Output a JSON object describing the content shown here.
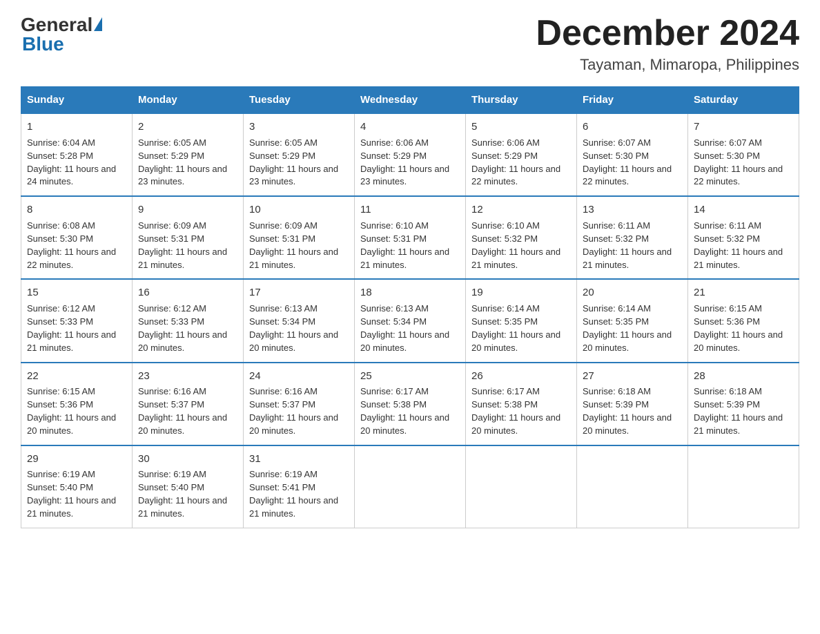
{
  "header": {
    "logo_general": "General",
    "logo_blue": "Blue",
    "main_title": "December 2024",
    "subtitle": "Tayaman, Mimaropa, Philippines"
  },
  "columns": [
    "Sunday",
    "Monday",
    "Tuesday",
    "Wednesday",
    "Thursday",
    "Friday",
    "Saturday"
  ],
  "weeks": [
    [
      {
        "day": "1",
        "sunrise": "6:04 AM",
        "sunset": "5:28 PM",
        "daylight": "11 hours and 24 minutes."
      },
      {
        "day": "2",
        "sunrise": "6:05 AM",
        "sunset": "5:29 PM",
        "daylight": "11 hours and 23 minutes."
      },
      {
        "day": "3",
        "sunrise": "6:05 AM",
        "sunset": "5:29 PM",
        "daylight": "11 hours and 23 minutes."
      },
      {
        "day": "4",
        "sunrise": "6:06 AM",
        "sunset": "5:29 PM",
        "daylight": "11 hours and 23 minutes."
      },
      {
        "day": "5",
        "sunrise": "6:06 AM",
        "sunset": "5:29 PM",
        "daylight": "11 hours and 22 minutes."
      },
      {
        "day": "6",
        "sunrise": "6:07 AM",
        "sunset": "5:30 PM",
        "daylight": "11 hours and 22 minutes."
      },
      {
        "day": "7",
        "sunrise": "6:07 AM",
        "sunset": "5:30 PM",
        "daylight": "11 hours and 22 minutes."
      }
    ],
    [
      {
        "day": "8",
        "sunrise": "6:08 AM",
        "sunset": "5:30 PM",
        "daylight": "11 hours and 22 minutes."
      },
      {
        "day": "9",
        "sunrise": "6:09 AM",
        "sunset": "5:31 PM",
        "daylight": "11 hours and 21 minutes."
      },
      {
        "day": "10",
        "sunrise": "6:09 AM",
        "sunset": "5:31 PM",
        "daylight": "11 hours and 21 minutes."
      },
      {
        "day": "11",
        "sunrise": "6:10 AM",
        "sunset": "5:31 PM",
        "daylight": "11 hours and 21 minutes."
      },
      {
        "day": "12",
        "sunrise": "6:10 AM",
        "sunset": "5:32 PM",
        "daylight": "11 hours and 21 minutes."
      },
      {
        "day": "13",
        "sunrise": "6:11 AM",
        "sunset": "5:32 PM",
        "daylight": "11 hours and 21 minutes."
      },
      {
        "day": "14",
        "sunrise": "6:11 AM",
        "sunset": "5:32 PM",
        "daylight": "11 hours and 21 minutes."
      }
    ],
    [
      {
        "day": "15",
        "sunrise": "6:12 AM",
        "sunset": "5:33 PM",
        "daylight": "11 hours and 21 minutes."
      },
      {
        "day": "16",
        "sunrise": "6:12 AM",
        "sunset": "5:33 PM",
        "daylight": "11 hours and 20 minutes."
      },
      {
        "day": "17",
        "sunrise": "6:13 AM",
        "sunset": "5:34 PM",
        "daylight": "11 hours and 20 minutes."
      },
      {
        "day": "18",
        "sunrise": "6:13 AM",
        "sunset": "5:34 PM",
        "daylight": "11 hours and 20 minutes."
      },
      {
        "day": "19",
        "sunrise": "6:14 AM",
        "sunset": "5:35 PM",
        "daylight": "11 hours and 20 minutes."
      },
      {
        "day": "20",
        "sunrise": "6:14 AM",
        "sunset": "5:35 PM",
        "daylight": "11 hours and 20 minutes."
      },
      {
        "day": "21",
        "sunrise": "6:15 AM",
        "sunset": "5:36 PM",
        "daylight": "11 hours and 20 minutes."
      }
    ],
    [
      {
        "day": "22",
        "sunrise": "6:15 AM",
        "sunset": "5:36 PM",
        "daylight": "11 hours and 20 minutes."
      },
      {
        "day": "23",
        "sunrise": "6:16 AM",
        "sunset": "5:37 PM",
        "daylight": "11 hours and 20 minutes."
      },
      {
        "day": "24",
        "sunrise": "6:16 AM",
        "sunset": "5:37 PM",
        "daylight": "11 hours and 20 minutes."
      },
      {
        "day": "25",
        "sunrise": "6:17 AM",
        "sunset": "5:38 PM",
        "daylight": "11 hours and 20 minutes."
      },
      {
        "day": "26",
        "sunrise": "6:17 AM",
        "sunset": "5:38 PM",
        "daylight": "11 hours and 20 minutes."
      },
      {
        "day": "27",
        "sunrise": "6:18 AM",
        "sunset": "5:39 PM",
        "daylight": "11 hours and 20 minutes."
      },
      {
        "day": "28",
        "sunrise": "6:18 AM",
        "sunset": "5:39 PM",
        "daylight": "11 hours and 21 minutes."
      }
    ],
    [
      {
        "day": "29",
        "sunrise": "6:19 AM",
        "sunset": "5:40 PM",
        "daylight": "11 hours and 21 minutes."
      },
      {
        "day": "30",
        "sunrise": "6:19 AM",
        "sunset": "5:40 PM",
        "daylight": "11 hours and 21 minutes."
      },
      {
        "day": "31",
        "sunrise": "6:19 AM",
        "sunset": "5:41 PM",
        "daylight": "11 hours and 21 minutes."
      },
      null,
      null,
      null,
      null
    ]
  ],
  "labels": {
    "sunrise": "Sunrise:",
    "sunset": "Sunset:",
    "daylight": "Daylight:"
  }
}
